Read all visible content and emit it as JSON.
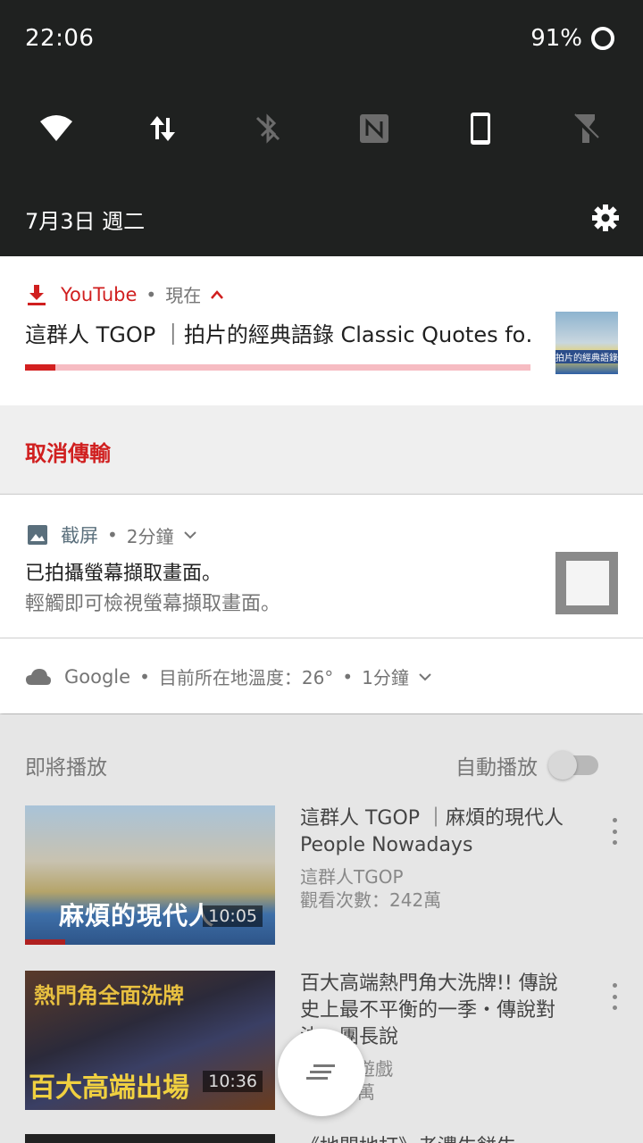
{
  "status_bar": {
    "time": "22:06",
    "battery": "91%"
  },
  "quick_settings": {
    "tiles": [
      "wifi-icon",
      "mobile-data-icon",
      "bluetooth-off-icon",
      "nfc-icon",
      "screen-rotation-icon",
      "flashlight-off-icon"
    ],
    "date": "7月3日 週二"
  },
  "notifications": {
    "youtube": {
      "app": "YouTube",
      "sep": "•",
      "time": "現在",
      "title": "這群人 TGOP ｜拍片的經典語錄 Classic Quotes fo‥",
      "progress": 0.06,
      "thumb_caption": "拍片的經典語錄",
      "action": "取消傳輸"
    },
    "screenshot": {
      "app": "截屏",
      "sep": "•",
      "time": "2分鐘",
      "title": "已拍攝螢幕擷取畫面。",
      "subtitle": "輕觸即可檢視螢幕擷取畫面。"
    },
    "google": {
      "app": "Google",
      "sep": "•",
      "text": "目前所在地溫度：26°",
      "time": "1分鐘"
    }
  },
  "background": {
    "up_next": "即將播放",
    "autoplay": "自動播放",
    "autoplay_on": false,
    "videos": [
      {
        "title": "這群人 TGOP ｜麻煩的現代人 People Nowadays",
        "channel": "這群人TGOP",
        "views": "觀看次數：242萬",
        "duration": "10:05",
        "thumb_caption": "麻煩的現代人"
      },
      {
        "title": "百大高端熱門角大洗牌!! 傳說史上最不平衡的一季・傳說對決・團長說",
        "channel": "遊戲",
        "views": "萬",
        "duration": "10:36",
        "thumb_caption_top": "熱門角全面洗牌",
        "thumb_caption_bottom": "百大高端出場"
      },
      {
        "title": "《地門地打》老濃生餅牛"
      }
    ]
  },
  "colors": {
    "youtube_red": "#d01f1f",
    "shade_dark": "#1f2120"
  }
}
